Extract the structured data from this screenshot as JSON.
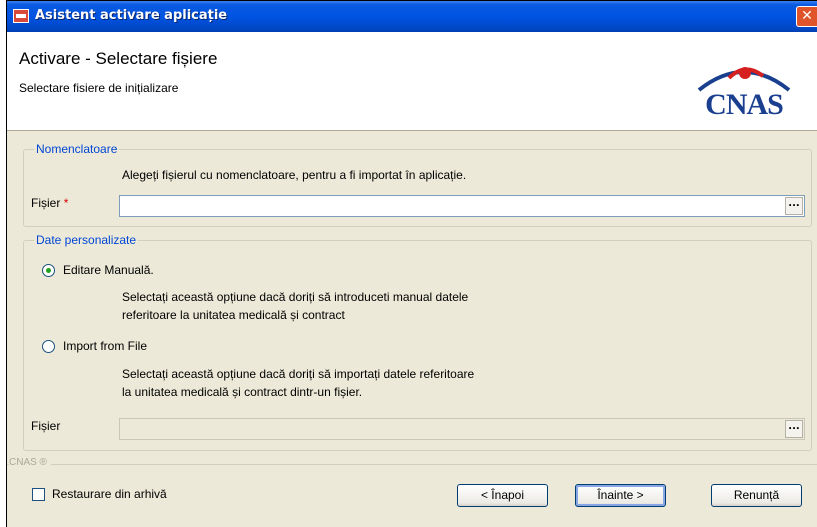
{
  "window": {
    "title": "Asistent activare aplicație",
    "close_glyph": "✕"
  },
  "header": {
    "title": "Activare - Selectare fișiere",
    "subtitle": "Selectare fisiere de inițializare",
    "logo_text": "CNAS",
    "logo_colors": {
      "arc": "#1b3f8f",
      "swoosh": "#d62020"
    }
  },
  "nomenclatoare": {
    "legend": "Nomenclatoare",
    "description": "Alegeți fișierul cu nomenclatoare, pentru a fi importat în aplicație.",
    "file_label": "Fișier",
    "required_mark": "*",
    "file_value": "",
    "browse_label": "..."
  },
  "date_personalizate": {
    "legend": "Date personalizate",
    "option_manual": {
      "label": "Editare Manuală.",
      "selected": true,
      "desc_line1": "Selectați această opțiune dacă doriți să introduceti manual datele",
      "desc_line2": "referitoare la unitatea medicală și contract"
    },
    "option_import": {
      "label": "Import from File",
      "selected": false,
      "desc_line1": "Selectați această opțiune dacă doriți să importați datele referitoare",
      "desc_line2": "la unitatea medicală și contract dintr-un fișier."
    },
    "file_label": "Fișier",
    "file_value": "",
    "browse_label": "..."
  },
  "footer": {
    "brand_mark": "CNAS ®",
    "restore_checkbox_label": "Restaurare din arhivă",
    "restore_checked": false,
    "back_button": "< Înapoi",
    "next_button": "Înainte >",
    "cancel_button": "Renunță"
  },
  "colors": {
    "title_bar": "#0054e3",
    "group_legend": "#0046d5",
    "dialog_bg": "#ece9d8",
    "required": "#d40000"
  }
}
